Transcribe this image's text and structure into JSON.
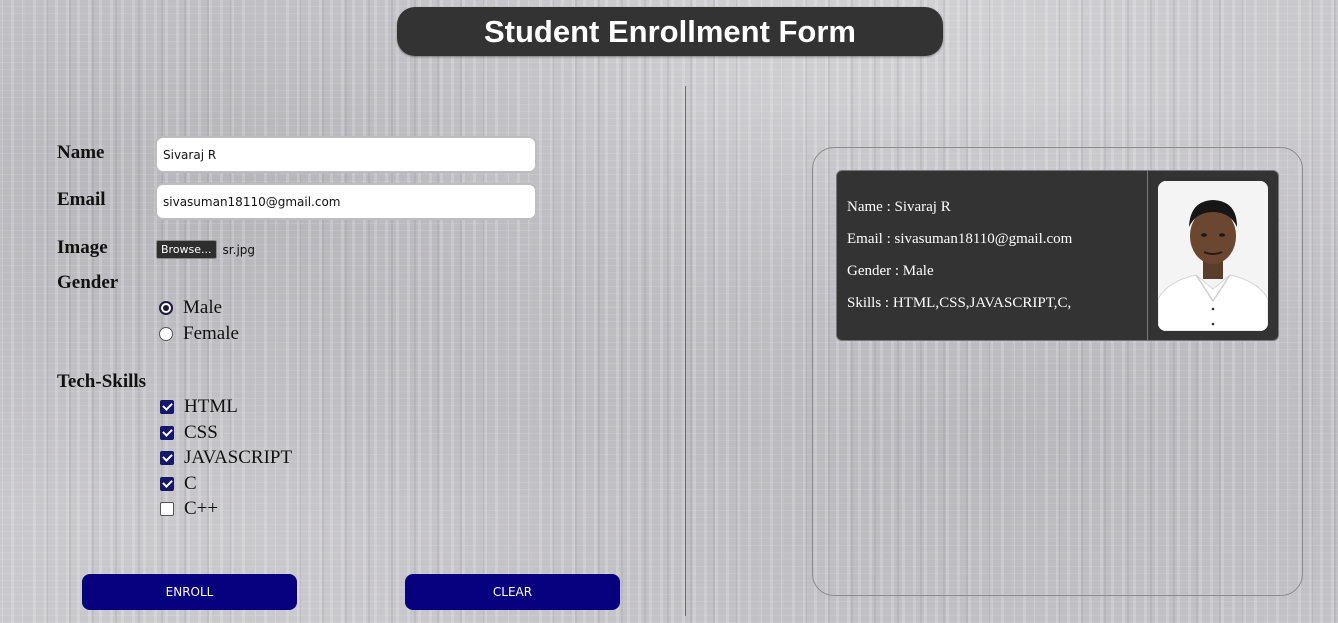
{
  "header": {
    "title": "Student Enrollment Form"
  },
  "form": {
    "name": {
      "label": "Name",
      "value": "Sivaraj R"
    },
    "email": {
      "label": "Email",
      "value": "sivasuman18110@gmail.com"
    },
    "image": {
      "label": "Image",
      "button_label": "Browse...",
      "file_name": "sr.jpg"
    },
    "gender": {
      "label": "Gender",
      "options": [
        {
          "label": "Male",
          "checked": true
        },
        {
          "label": "Female",
          "checked": false
        }
      ]
    },
    "skills": {
      "label": "Tech-Skills",
      "options": [
        {
          "label": "HTML",
          "checked": true
        },
        {
          "label": "CSS",
          "checked": true
        },
        {
          "label": "JAVASCRIPT",
          "checked": true
        },
        {
          "label": "C",
          "checked": true
        },
        {
          "label": "C++",
          "checked": false
        }
      ]
    },
    "enroll_label": "ENROLL",
    "clear_label": "CLEAR"
  },
  "preview": {
    "name_line": "Name : Sivaraj R",
    "email_line": "Email : sivasuman18110@gmail.com",
    "gender_line": "Gender : Male",
    "skills_line": "Skills : HTML,CSS,JAVASCRIPT,C,"
  },
  "colors": {
    "button_bg": "#07007f",
    "title_bg": "#333333",
    "card_bg": "#333333",
    "checkbox_checked": "#16166a"
  }
}
